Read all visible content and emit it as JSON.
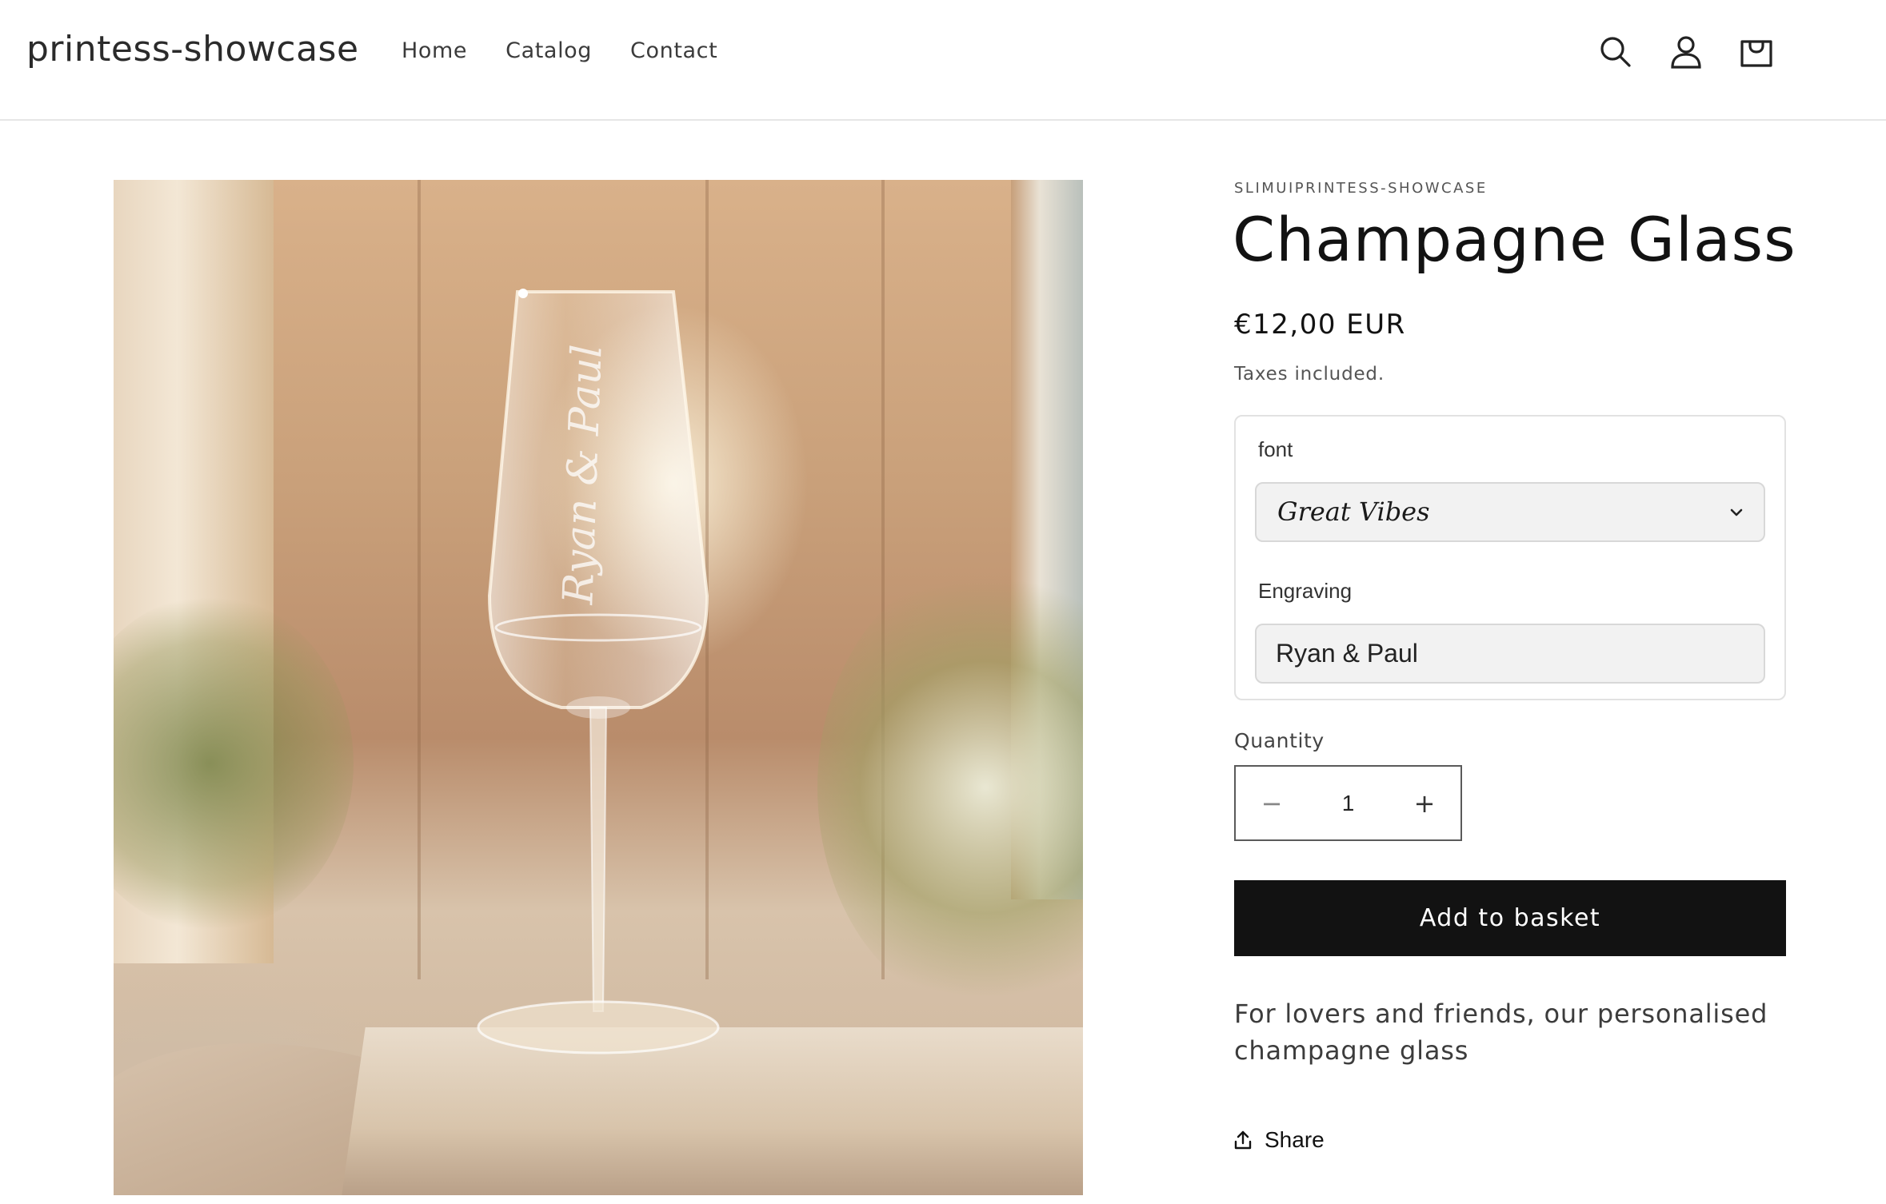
{
  "header": {
    "logo": "printess-showcase",
    "nav": [
      {
        "label": "Home"
      },
      {
        "label": "Catalog"
      },
      {
        "label": "Contact"
      }
    ],
    "icons": [
      "search-icon",
      "account-icon",
      "cart-icon"
    ]
  },
  "product": {
    "vendor": "SLIMUIPRINTESS-SHOWCASE",
    "title": "Champagne Glass",
    "price": "€12,00 EUR",
    "tax_note": "Taxes included.",
    "image_engraving_text": "Ryan & Paul",
    "options": {
      "font_label": "font",
      "font_value": "Great Vibes",
      "engraving_label": "Engraving",
      "engraving_value": "Ryan & Paul"
    },
    "quantity": {
      "label": "Quantity",
      "value": "1",
      "minus": "−",
      "plus": "+"
    },
    "add_to_basket": "Add to basket",
    "description": "For lovers and friends, our personalised champagne glass",
    "share": "Share"
  },
  "colors": {
    "button_bg": "#121212",
    "button_text": "#ffffff",
    "input_bg": "#f2f2f2"
  }
}
